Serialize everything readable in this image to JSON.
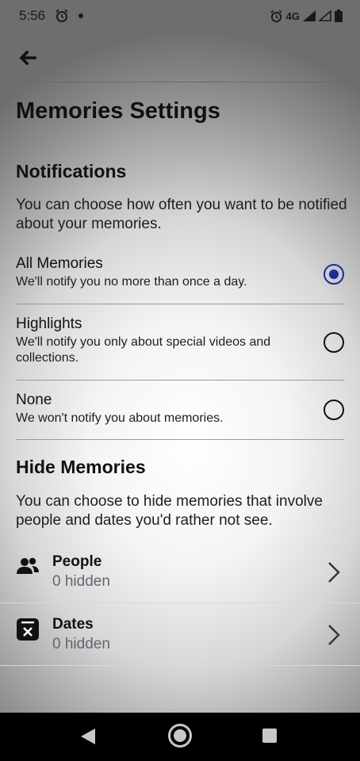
{
  "status": {
    "time": "5:56",
    "network": "4G"
  },
  "header": {
    "title": "Memories Settings"
  },
  "notifications": {
    "title": "Notifications",
    "description": "You can choose how often you want to be notified about your memories.",
    "options": [
      {
        "label": "All Memories",
        "description": "We'll notify you no more than once a day.",
        "selected": true
      },
      {
        "label": "Highlights",
        "description": "We'll notify you only about special videos and collections.",
        "selected": false
      },
      {
        "label": "None",
        "description": "We won't notify you about memories.",
        "selected": false
      }
    ]
  },
  "hide_memories": {
    "title": "Hide Memories",
    "description": "You can choose to hide memories that involve people and dates you'd rather not see.",
    "items": [
      {
        "label": "People",
        "count": "0 hidden",
        "icon": "people-icon"
      },
      {
        "label": "Dates",
        "count": "0 hidden",
        "icon": "calendar-x-icon"
      }
    ]
  },
  "colors": {
    "radio_selected": "#1c2b9c",
    "secondary_text": "#606770",
    "nav_bar": "#000000"
  }
}
